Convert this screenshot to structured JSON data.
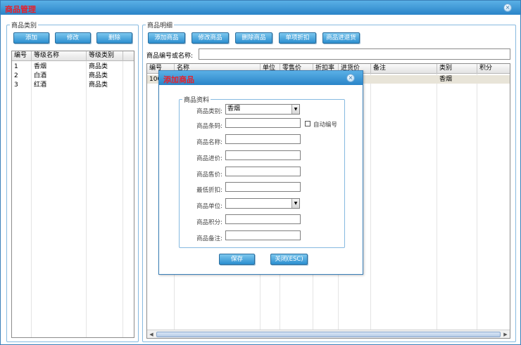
{
  "window": {
    "title": "商品管理",
    "close_glyph": "×"
  },
  "categories": {
    "legend": "商品类别",
    "buttons": {
      "add": "添加",
      "edit": "修改",
      "delete": "删除"
    },
    "columns": [
      "编号",
      "等级名称",
      "等级类别"
    ],
    "rows": [
      [
        "1",
        "香烟",
        "商品类"
      ],
      [
        "2",
        "白酒",
        "商品类"
      ],
      [
        "3",
        "红酒",
        "商品类"
      ]
    ]
  },
  "details": {
    "legend": "商品明细",
    "buttons": {
      "add": "添加商品",
      "edit": "修改商品",
      "delete": "删除商品",
      "discount": "单项折扣",
      "return": "商品进退货"
    },
    "search_label": "商品编号或名称:",
    "search_value": "",
    "columns": [
      "编号",
      "名称",
      "单位",
      "零售价",
      "折扣率",
      "进货价",
      "备注",
      "类别",
      "积分"
    ],
    "rows": [
      [
        "100",
        "",
        "",
        "",
        "",
        "",
        "",
        "香烟",
        ""
      ]
    ]
  },
  "dialog": {
    "title": "添加商品",
    "close_glyph": "×",
    "legend": "商品资料",
    "fields": {
      "category_label": "商品类别:",
      "category_value": "香烟",
      "barcode_label": "商品条码:",
      "barcode_value": "",
      "auto_number_label": "自动编号",
      "name_label": "商品名称:",
      "name_value": "",
      "cost_label": "商品进价:",
      "cost_value": "",
      "price_label": "商品售价:",
      "price_value": "",
      "min_discount_label": "最低折扣:",
      "min_discount_value": "",
      "unit_label": "商品单位:",
      "unit_value": "",
      "points_label": "商品积分:",
      "points_value": "",
      "note_label": "商品备注:",
      "note_value": ""
    },
    "save_label": "保存",
    "close_label": "关闭(ESC)"
  },
  "colors": {
    "title_text": "#e8202a",
    "titlebar": "#2a84c8",
    "button": "#2c8fd0",
    "selected_row": "#e8e4d8"
  }
}
